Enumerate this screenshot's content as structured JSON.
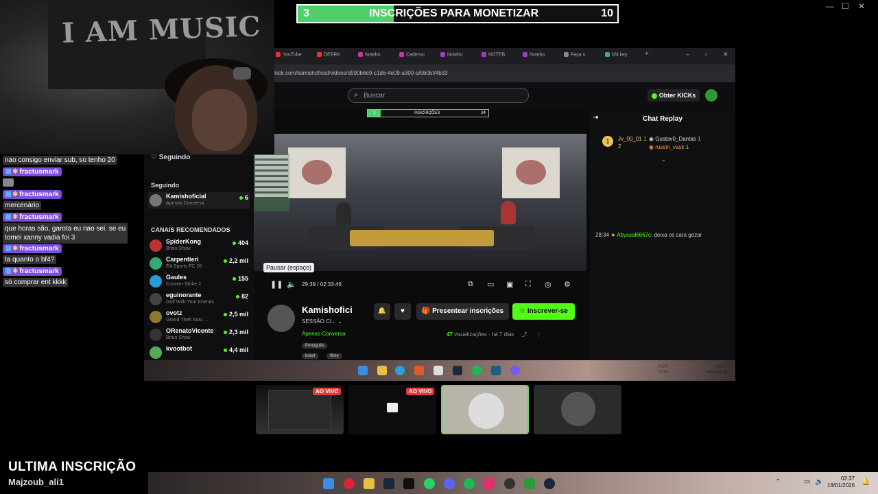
{
  "monetize": {
    "current": "3",
    "label": "INSCRIÇÕES PARA MONETIZAR",
    "goal": "10",
    "progress": 0.3,
    "color": "#4fd06a"
  },
  "window_controls": {
    "minimize": "—",
    "maximize": "☐",
    "close": "✕"
  },
  "webcam": {
    "shirt_text": "I AM MUSIC"
  },
  "chat": {
    "lines": [
      {
        "type": "text",
        "text": "nao consigo enviar sub, so tenho 20"
      },
      {
        "type": "user",
        "text": "fractusmark"
      },
      {
        "type": "emote",
        "text": ""
      },
      {
        "type": "user",
        "text": "fractusmark"
      },
      {
        "type": "text",
        "text": "mercenário"
      },
      {
        "type": "user",
        "text": "fractusmark"
      },
      {
        "type": "text",
        "text": "que horas são, garota eu nao sei. se eu"
      },
      {
        "type": "text",
        "text": "tomei xanny vadia foi 3"
      },
      {
        "type": "user",
        "text": "fractusmark"
      },
      {
        "type": "text",
        "text": "ta quanto o bf4?"
      },
      {
        "type": "user",
        "text": "fractusmark"
      },
      {
        "type": "text",
        "text": "só comprar ent kkkk"
      }
    ]
  },
  "browser": {
    "tabs": [
      "YouTube",
      "DEBRK",
      "Notebo",
      "Caderno",
      "Notebo",
      "NOTEB",
      "Notebo",
      "Faça o",
      "bf4 key"
    ],
    "url": "kick.com/kamishoficial/videos/d590b8e9-c1d6-4e09-a300-a/bb0bf/4b33"
  },
  "kick": {
    "search_placeholder": "Buscar",
    "get_kicks": "Obter KICKs",
    "following_header": "Seguindo",
    "following_label": "Seguindo",
    "recommended_label": "CANAIS RECOMENDADOS",
    "following": [
      {
        "name": "Kamishoficial",
        "sub": "Apenas Conversa",
        "viewers": "6"
      }
    ],
    "recommended": [
      {
        "name": "SpiderKong",
        "sub": "Brain Show",
        "viewers": "404"
      },
      {
        "name": "Carpentieri",
        "sub": "EA Sports FC 26",
        "viewers": "2,2 mil"
      },
      {
        "name": "Gaules",
        "sub": "Counter-Strike 2",
        "viewers": "155"
      },
      {
        "name": "eguinorante",
        "sub": "Golf With Your Friends",
        "viewers": "82"
      },
      {
        "name": "ovotz",
        "sub": "Grand Theft Auto ...",
        "viewers": "2,5 mil"
      },
      {
        "name": "ORenatoVicente",
        "sub": "Brain Show",
        "viewers": "2,3 mil"
      },
      {
        "name": "kvootbot",
        "sub": "",
        "viewers": "4,4 mil"
      }
    ],
    "mini_bar": {
      "current": "1",
      "label": "INSCRIÇÕES",
      "goal": "34"
    },
    "tooltip": "Pausar (espaço)",
    "time": "29:39 / 02:33:46",
    "channel": {
      "name": "Kamishofici",
      "session": "SESSÃO CI...",
      "category": "Apenas Conversa",
      "tags": [
        "Português",
        "brasil",
        "filme"
      ],
      "gift_label": "Presentear inscrições",
      "subscribe_label": "Inscrever-se",
      "views_count": "47",
      "views_label": "visualizações",
      "ago": "há 7 dias"
    },
    "replay": {
      "title": "Chat Replay",
      "top": [
        {
          "name": "Jv_00_01",
          "count": "1"
        },
        {
          "name": "Gustav0_Dantas",
          "count": "1"
        },
        {
          "name": "",
          "count": "2"
        },
        {
          "name": "russin_vask",
          "count": "1"
        }
      ],
      "message_time": "28:34",
      "message_user": "Abyssal6667c:",
      "message_text": "deixa os cara gozar"
    },
    "inner_clock": {
      "time": "02:37",
      "date": "18/01/2026",
      "lang": "POR",
      "layout": "PTB2"
    }
  },
  "thumbnails": {
    "live_label": "AO VIVO"
  },
  "last_sub": {
    "title": "ULTIMA INSCRIÇÃO",
    "name": "Majzoub_ali1"
  },
  "taskbar": {
    "time": "02:37",
    "date": "18/01/2026"
  }
}
